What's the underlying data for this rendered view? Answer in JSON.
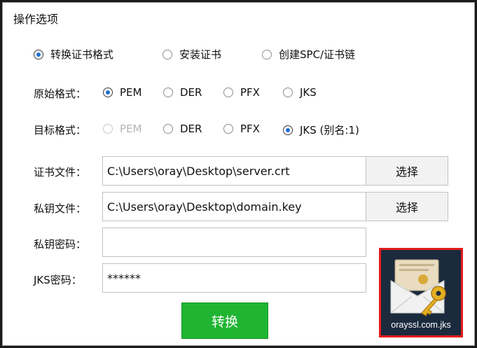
{
  "section_title": "操作选项",
  "mode_options": [
    {
      "label": "转换证书格式",
      "checked": true
    },
    {
      "label": "安装证书",
      "checked": false
    },
    {
      "label": "创建SPC/证书链",
      "checked": false
    }
  ],
  "source_format": {
    "label": "原始格式：",
    "options": [
      {
        "label": "PEM",
        "checked": true
      },
      {
        "label": "DER",
        "checked": false
      },
      {
        "label": "PFX",
        "checked": false
      },
      {
        "label": "JKS",
        "checked": false
      }
    ]
  },
  "target_format": {
    "label": "目标格式：",
    "options": [
      {
        "label": "PEM",
        "checked": false,
        "disabled": true
      },
      {
        "label": "DER",
        "checked": false
      },
      {
        "label": "PFX",
        "checked": false
      },
      {
        "label": "JKS (别名:1)",
        "checked": true
      }
    ]
  },
  "cert_file": {
    "label": "证书文件：",
    "value": "C:\\Users\\oray\\Desktop\\server.crt",
    "button": "选择"
  },
  "key_file": {
    "label": "私钥文件：",
    "value": "C:\\Users\\oray\\Desktop\\domain.key",
    "button": "选择"
  },
  "key_password": {
    "label": "私钥密码：",
    "value": ""
  },
  "jks_password": {
    "label": "JKS密码：",
    "value": "******"
  },
  "convert_button": "转换",
  "output_file": {
    "label": "orayssl.com.jks",
    "icon": "jks-keystore-icon"
  }
}
